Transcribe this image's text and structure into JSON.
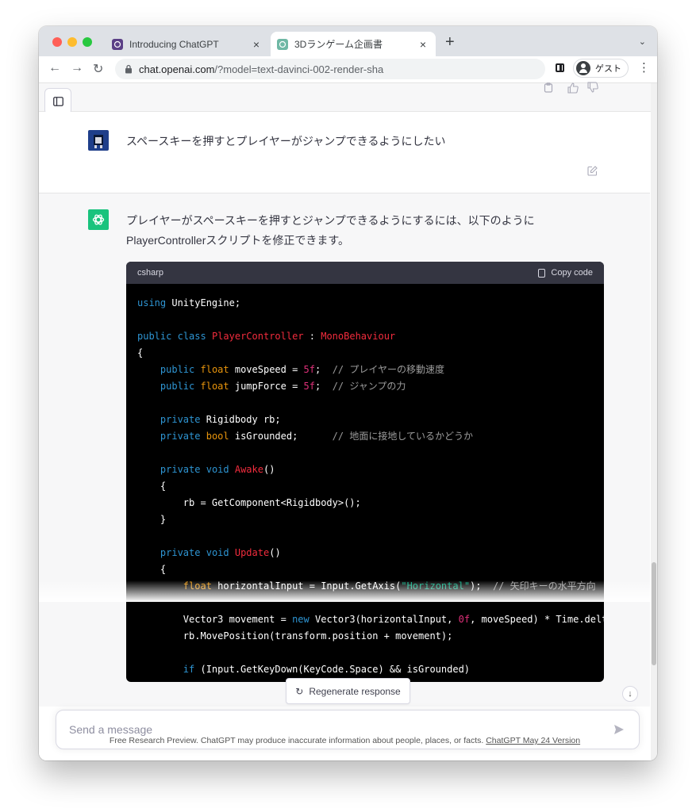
{
  "browser": {
    "tabs": [
      {
        "title": "Introducing ChatGPT",
        "close": "×"
      },
      {
        "title": "3Dランゲーム企画書",
        "close": "×"
      }
    ],
    "new_tab": "+",
    "tab_menu": "⌄",
    "nav": {
      "back": "←",
      "forward": "→",
      "reload": "↻"
    },
    "url_host": "chat.openai.com",
    "url_path": "/?model=text-davinci-002-render-sha",
    "profile_label": "ゲスト",
    "menu": "⋮"
  },
  "conversation": {
    "user_message": "スペースキーを押すとプレイヤーがジャンプできるようにしたい",
    "assistant_intro_line1": "プレイヤーがスペースキーを押すとジャンプできるようにするには、以下のように",
    "assistant_intro_line2": "PlayerControllerスクリプトを修正できます。",
    "code_language": "csharp",
    "copy_code_label": "Copy code",
    "code_lines": [
      [
        {
          "t": "using",
          "c": "kw"
        },
        {
          "t": " UnityEngine;"
        }
      ],
      [],
      [
        {
          "t": "public",
          "c": "kw"
        },
        {
          "t": " "
        },
        {
          "t": "class",
          "c": "kw"
        },
        {
          "t": " "
        },
        {
          "t": "PlayerController",
          "c": "cls"
        },
        {
          "t": " : "
        },
        {
          "t": "MonoBehaviour",
          "c": "cls"
        }
      ],
      [
        {
          "t": "{"
        }
      ],
      [
        {
          "t": "    "
        },
        {
          "t": "public",
          "c": "kw"
        },
        {
          "t": " "
        },
        {
          "t": "float",
          "c": "ty"
        },
        {
          "t": " moveSpeed = "
        },
        {
          "t": "5f",
          "c": "num"
        },
        {
          "t": ";  "
        },
        {
          "t": "// プレイヤーの移動速度",
          "c": "cm"
        }
      ],
      [
        {
          "t": "    "
        },
        {
          "t": "public",
          "c": "kw"
        },
        {
          "t": " "
        },
        {
          "t": "float",
          "c": "ty"
        },
        {
          "t": " jumpForce = "
        },
        {
          "t": "5f",
          "c": "num"
        },
        {
          "t": ";  "
        },
        {
          "t": "// ジャンプの力",
          "c": "cm"
        }
      ],
      [],
      [
        {
          "t": "    "
        },
        {
          "t": "private",
          "c": "kw"
        },
        {
          "t": " Rigidbody rb;"
        }
      ],
      [
        {
          "t": "    "
        },
        {
          "t": "private",
          "c": "kw"
        },
        {
          "t": " "
        },
        {
          "t": "bool",
          "c": "ty"
        },
        {
          "t": " isGrounded;      "
        },
        {
          "t": "// 地面に接地しているかどうか",
          "c": "cm"
        }
      ],
      [],
      [
        {
          "t": "    "
        },
        {
          "t": "private",
          "c": "kw"
        },
        {
          "t": " "
        },
        {
          "t": "void",
          "c": "kw"
        },
        {
          "t": " "
        },
        {
          "t": "Awake",
          "c": "cls"
        },
        {
          "t": "()"
        }
      ],
      [
        {
          "t": "    {"
        }
      ],
      [
        {
          "t": "        rb = GetComponent<Rigidbody>();"
        }
      ],
      [
        {
          "t": "    }"
        }
      ],
      [],
      [
        {
          "t": "    "
        },
        {
          "t": "private",
          "c": "kw"
        },
        {
          "t": " "
        },
        {
          "t": "void",
          "c": "kw"
        },
        {
          "t": " "
        },
        {
          "t": "Update",
          "c": "cls"
        },
        {
          "t": "()"
        }
      ],
      [
        {
          "t": "    {"
        }
      ],
      [
        {
          "t": "        "
        },
        {
          "t": "float",
          "c": "ty"
        },
        {
          "t": " horizontalInput = Input.GetAxis("
        },
        {
          "t": "\"Horizontal\"",
          "c": "str"
        },
        {
          "t": ");  "
        },
        {
          "t": "// 矢印キーの水平方向",
          "c": "cm"
        }
      ],
      [],
      [
        {
          "t": "        Vector3 movement = "
        },
        {
          "t": "new",
          "c": "kw"
        },
        {
          "t": " Vector3(horizontalInput, "
        },
        {
          "t": "0f",
          "c": "num"
        },
        {
          "t": ", moveSpeed) * Time.deltaTime;"
        }
      ],
      [
        {
          "t": "        rb.MovePosition(transform.position + movement);"
        }
      ],
      [],
      [
        {
          "t": "        "
        },
        {
          "t": "if",
          "c": "kw"
        },
        {
          "t": " (Input.GetKeyDown(KeyCode.Space) && isGrounded)"
        }
      ]
    ]
  },
  "controls": {
    "regenerate_label": "Regenerate response",
    "scroll_down": "↓",
    "message_placeholder": "Send a message"
  },
  "footer": {
    "text": "Free Research Preview. ChatGPT may produce inaccurate information about people, places, or facts.",
    "link": "ChatGPT May 24 Version"
  },
  "colors": {
    "accent": "#19c37d",
    "code_keyword": "#2e95d3",
    "code_type": "#e9950c",
    "code_class": "#f22c3d",
    "code_number": "#df3079",
    "code_string": "#00a67d"
  },
  "icons": {
    "sidebar_toggle": "sidebar-toggle-icon",
    "copy": "clipboard-icon",
    "thumbs_up": "thumbs-up-icon",
    "thumbs_down": "thumbs-down-icon",
    "edit": "edit-icon",
    "send": "send-icon",
    "regenerate": "refresh-icon"
  }
}
